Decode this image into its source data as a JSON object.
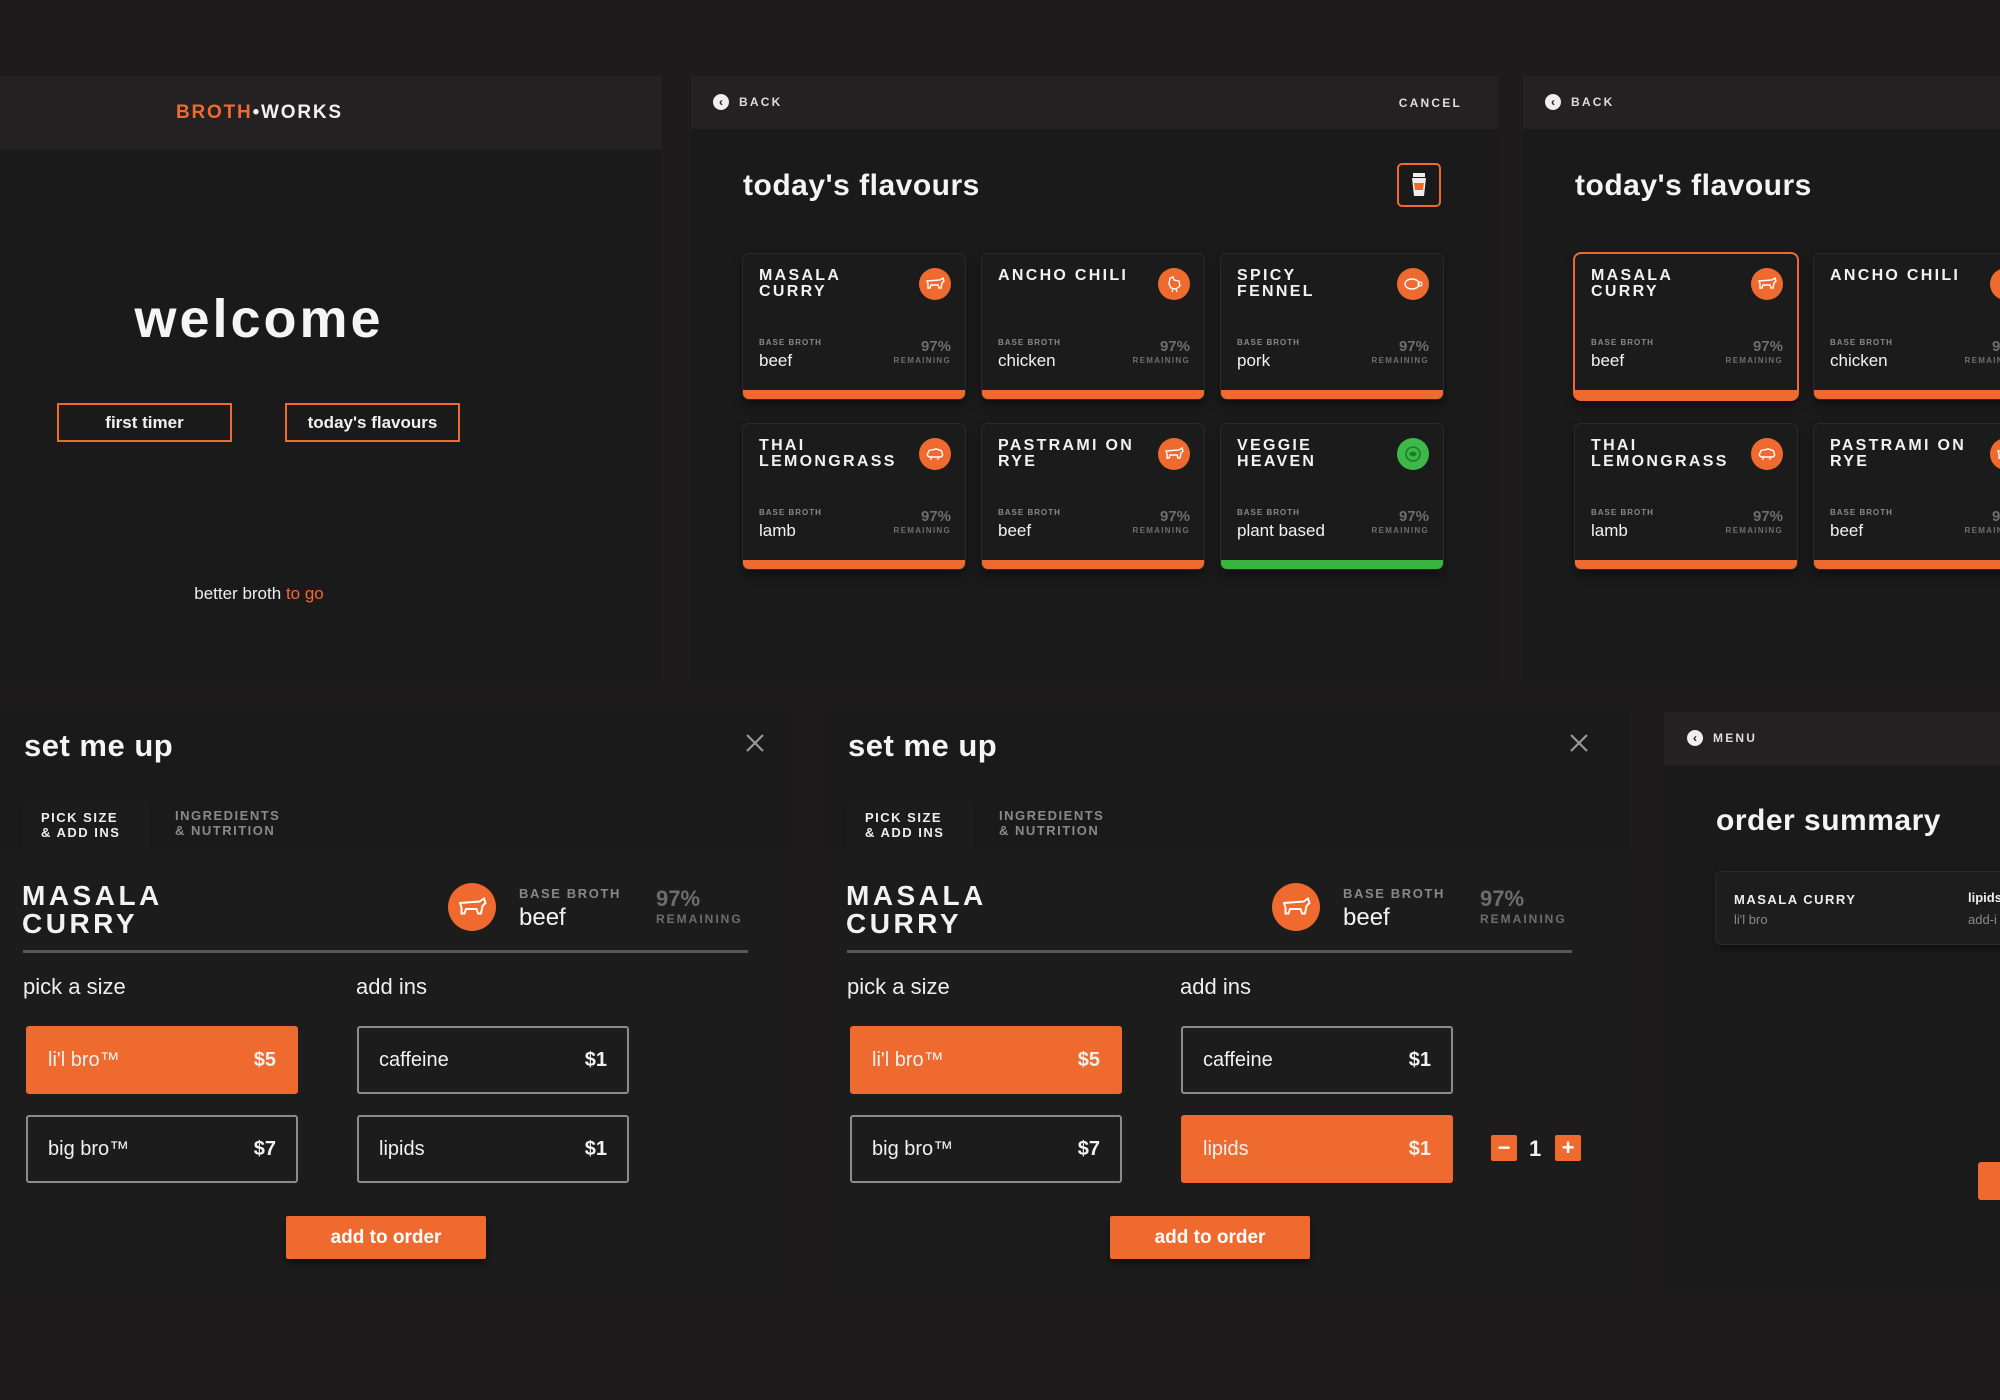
{
  "colors": {
    "accent": "#ef6a2e",
    "veggie": "#3db849",
    "panel": "#1b1a1a",
    "page": "#1d1b1c"
  },
  "welcome": {
    "brand_left": "BROTH",
    "brand_dot": "•",
    "brand_right": "WORKS",
    "headline": "welcome",
    "first_timer_label": "first timer",
    "todays_flavours_label": "today's flavours",
    "tagline_main": "better broth",
    "tagline_accent": "to go"
  },
  "flavours": {
    "back_label": "BACK",
    "cancel_label": "CANCEL",
    "title": "today's flavours",
    "base_label": "BASE BROTH",
    "remaining_label": "REMAINING",
    "items": [
      {
        "name": "MASALA CURRY",
        "base": "beef",
        "pct": "97%",
        "icon": "cow-icon"
      },
      {
        "name": "ANCHO CHILI",
        "base": "chicken",
        "pct": "97%",
        "icon": "chicken-icon"
      },
      {
        "name": "SPICY FENNEL",
        "base": "pork",
        "pct": "97%",
        "icon": "pig-icon"
      },
      {
        "name": "THAI LEMONGRASS",
        "base": "lamb",
        "pct": "97%",
        "icon": "lamb-icon"
      },
      {
        "name": "PASTRAMI ON RYE",
        "base": "beef",
        "pct": "97%",
        "icon": "cow-icon"
      },
      {
        "name": "VEGGIE HEAVEN",
        "base": "plant based",
        "pct": "97%",
        "icon": "leaf-icon"
      }
    ]
  },
  "setup": {
    "title": "set me up",
    "tab_size": "PICK SIZE & ADD INS",
    "tab_size_line1": "PICK SIZE",
    "tab_size_line2": "& ADD INS",
    "tab_ingredients_line1": "INGREDIENTS",
    "tab_ingredients_line2": "& NUTRITION",
    "flavour_line1": "MASALA",
    "flavour_line2": "CURRY",
    "base_label": "BASE BROTH",
    "base_value": "beef",
    "pct": "97%",
    "remaining_label": "REMAINING",
    "size_heading": "pick a size",
    "addins_heading": "add ins",
    "sizes": [
      {
        "label": "li'l bro™",
        "price": "$5"
      },
      {
        "label": "big bro™",
        "price": "$7"
      }
    ],
    "addins": [
      {
        "label": "caffeine",
        "price": "$1"
      },
      {
        "label": "lipids",
        "price": "$1"
      }
    ],
    "lipids_qty": "1",
    "minus": "−",
    "plus": "+",
    "add_to_order": "add to order"
  },
  "summary": {
    "menu_label": "MENU",
    "title": "order summary",
    "item_name": "MASALA CURRY",
    "item_size": "li'l bro",
    "item_addin": "lipids",
    "item_addin_sub": "add-i"
  }
}
